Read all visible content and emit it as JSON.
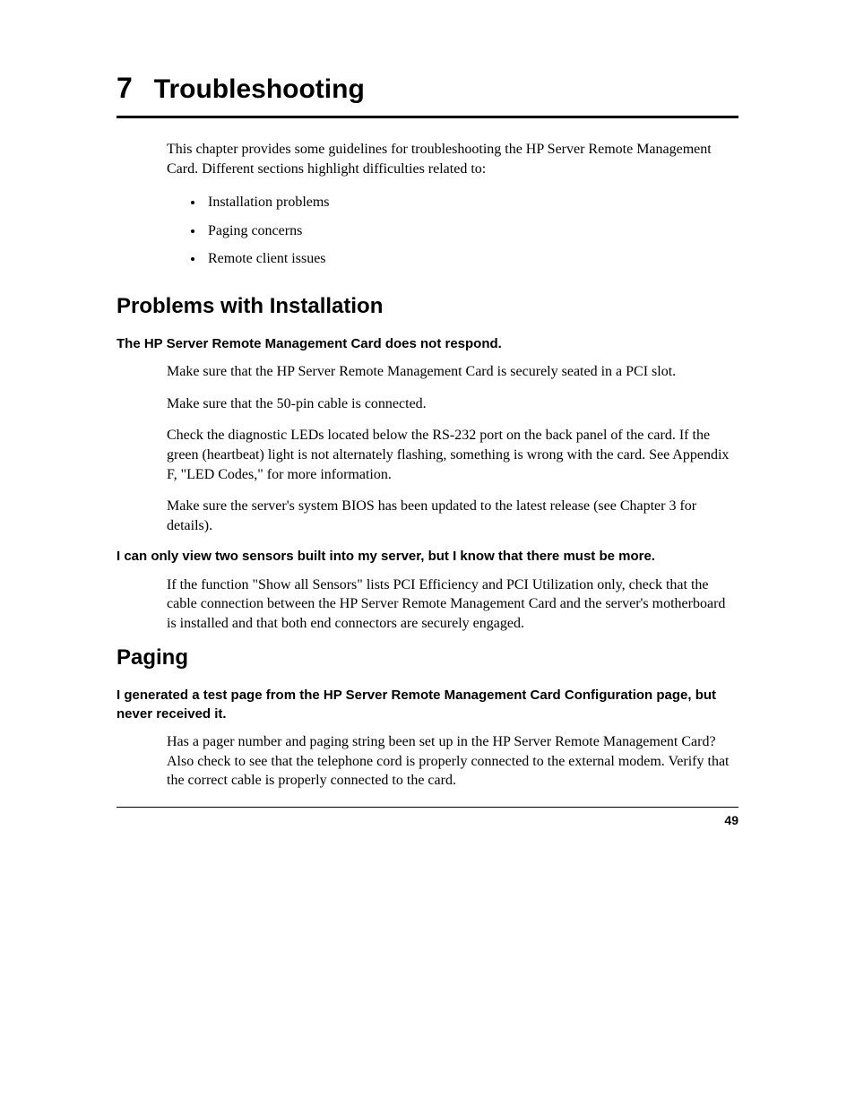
{
  "chapter": {
    "number": "7",
    "title": "Troubleshooting"
  },
  "intro": "This chapter provides some guidelines for troubleshooting the HP Server Remote Management Card. Different sections highlight difficulties related to:",
  "bullets": [
    "Installation problems",
    "Paging concerns",
    "Remote client issues"
  ],
  "sections": [
    {
      "heading": "Problems with Installation",
      "items": [
        {
          "subheading": "The HP Server Remote Management Card does not respond.",
          "paras": [
            "Make sure that the HP Server Remote Management Card is securely seated in a PCI slot.",
            "Make sure that the 50-pin cable is connected.",
            "Check the diagnostic LEDs located below the RS-232 port on the back panel of the card. If the green (heartbeat) light is not alternately flashing, something is wrong with the card. See Appendix F, \"LED Codes,\" for more information.",
            "Make sure the server's system BIOS has been updated to the latest release (see Chapter 3 for details)."
          ]
        },
        {
          "subheading": "I can only view two sensors built into my server, but I know that there must be more.",
          "paras": [
            "If the function \"Show all Sensors\" lists PCI Efficiency and PCI Utilization only, check that the cable connection between the HP Server Remote Management Card and the server's motherboard is installed and that both end connectors are securely engaged."
          ]
        }
      ]
    },
    {
      "heading": "Paging",
      "items": [
        {
          "subheading": "I generated a test page from the HP Server Remote Management Card Configuration page, but never received it.",
          "paras": [
            "Has a pager number and paging string been set up in the HP Server Remote Management Card? Also check to see that the telephone cord is properly connected to the external modem. Verify that the correct cable is properly connected to the card."
          ]
        }
      ]
    }
  ],
  "pageNumber": "49"
}
